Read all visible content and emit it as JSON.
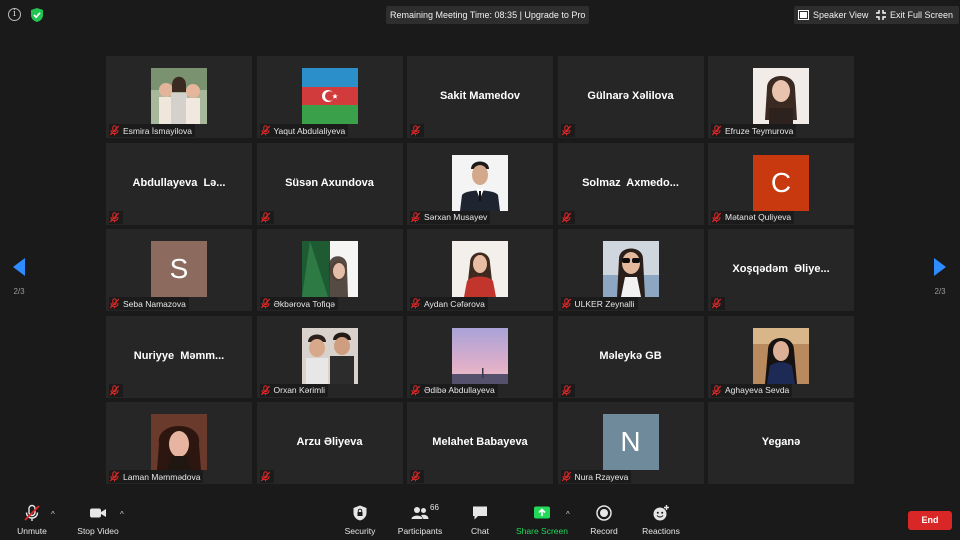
{
  "topbar": {
    "meeting_timer": "Remaining Meeting Time: 08:35 | Upgrade to Pro",
    "speaker_view": "Speaker View",
    "exit_full_screen": "Exit Full Screen"
  },
  "nav": {
    "page_left": "2/3",
    "page_right": "2/3"
  },
  "tiles": [
    {
      "caption": "Esmira İsmayilova",
      "kind": "photo",
      "photo": "family"
    },
    {
      "caption": "Yaqut Abdulaliyeva",
      "kind": "photo",
      "photo": "flag"
    },
    {
      "caption": "",
      "kind": "name",
      "big": "Sakit Mamedov"
    },
    {
      "caption": "",
      "kind": "name",
      "big": "Gülnarə Xəlilova"
    },
    {
      "caption": "Efruze Teymurova",
      "kind": "photo",
      "photo": "girl-light"
    },
    {
      "caption": "",
      "kind": "name",
      "big": "Abdullayeva  Lə..."
    },
    {
      "caption": "",
      "kind": "name",
      "big": "Süsən Axundova"
    },
    {
      "caption": "Sərxan Musayev",
      "kind": "photo",
      "photo": "suit"
    },
    {
      "caption": "",
      "kind": "name",
      "big": "Solmaz  Axmedo..."
    },
    {
      "caption": "Mətanət Quliyeva",
      "kind": "letter",
      "letter": "C",
      "color": "#c9390f"
    },
    {
      "caption": "Seba Namazova",
      "kind": "letter",
      "letter": "S",
      "color": "#8c6b5e"
    },
    {
      "caption": "Əkbərova Tofiqə",
      "kind": "photo",
      "photo": "green-girl"
    },
    {
      "caption": "Aydan Cəfərova",
      "kind": "photo",
      "photo": "red-girl"
    },
    {
      "caption": "ULKER Zeynalli",
      "kind": "photo",
      "photo": "sunglasses"
    },
    {
      "caption": "",
      "kind": "name",
      "big": "Xoşqədəm  Əliye..."
    },
    {
      "caption": "",
      "kind": "name",
      "big": "Nuriyye  Məmm..."
    },
    {
      "caption": "Orxan Kərimli",
      "kind": "photo",
      "photo": "boys"
    },
    {
      "caption": "Ədibə Abdullayeva",
      "kind": "photo",
      "photo": "sky"
    },
    {
      "caption": "",
      "kind": "name",
      "big": "Məleykə GB"
    },
    {
      "caption": "Aghayeva Sevda",
      "kind": "photo",
      "photo": "woman-dark"
    },
    {
      "caption": "Laman Məmmədova",
      "kind": "photo",
      "photo": "curly"
    },
    {
      "caption": "",
      "kind": "name",
      "big": "Arzu Əliyeva"
    },
    {
      "caption": "",
      "kind": "name",
      "big": "Melahet Babayeva"
    },
    {
      "caption": "Nura Rzayeva",
      "kind": "letter",
      "letter": "N",
      "color": "#6f8a9a"
    },
    {
      "caption": "",
      "kind": "name",
      "big": "Yeganə",
      "nomic": true
    }
  ],
  "toolbar": {
    "unmute": "Unmute",
    "stop_video": "Stop Video",
    "security": "Security",
    "participants": "Participants",
    "participants_count": "66",
    "chat": "Chat",
    "share_screen": "Share Screen",
    "record": "Record",
    "reactions": "Reactions",
    "end": "End"
  },
  "colors": {
    "accent_blue": "#2d8cff",
    "share_green": "#23d959",
    "end_red": "#d92626",
    "muted_red": "#e02828"
  }
}
